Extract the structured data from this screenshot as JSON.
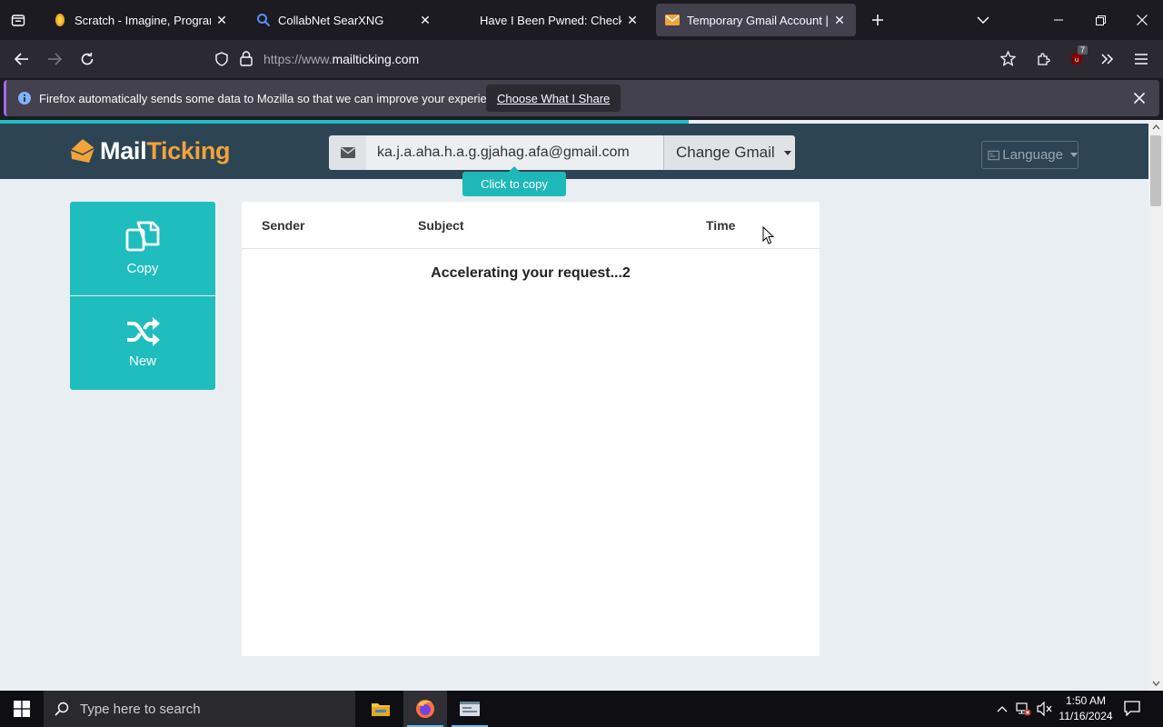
{
  "browser": {
    "tabs": [
      {
        "title": "Scratch - Imagine, Program, Sh",
        "icon": "scratch-favicon"
      },
      {
        "title": "CollabNet SearXNG",
        "icon": "search-favicon"
      },
      {
        "title": "Have I Been Pwned: Check if yo",
        "icon": "none"
      },
      {
        "title": "Temporary Gmail Account | Gm",
        "icon": "mail-favicon",
        "active": true
      }
    ],
    "url_prefix": "https://www.",
    "url_domain": "mailticking.com",
    "extension_badge": "7"
  },
  "notification": {
    "text": "Firefox automatically sends some data to Mozilla so that we can improve your experience.",
    "button": "Choose What I Share"
  },
  "site": {
    "logo_mail": "Mail",
    "logo_ticking": "Ticking",
    "email": "ka.j.a.aha.h.a.g.gjahag.afa@gmail.com",
    "change_button": "Change Gmail",
    "copy_tip": "Click to copy",
    "language": "Language",
    "side_buttons": {
      "copy": "Copy",
      "new": "New"
    },
    "columns": {
      "sender": "Sender",
      "subject": "Subject",
      "time": "Time"
    },
    "loading_text": "Accelerating your request...2",
    "colors": {
      "header": "#2d4454",
      "accent": "#1fbdbd",
      "logo_orange": "#f2a33a"
    }
  },
  "taskbar": {
    "search_placeholder": "Type here to search",
    "time": "1:50 AM",
    "date": "11/16/2024"
  }
}
